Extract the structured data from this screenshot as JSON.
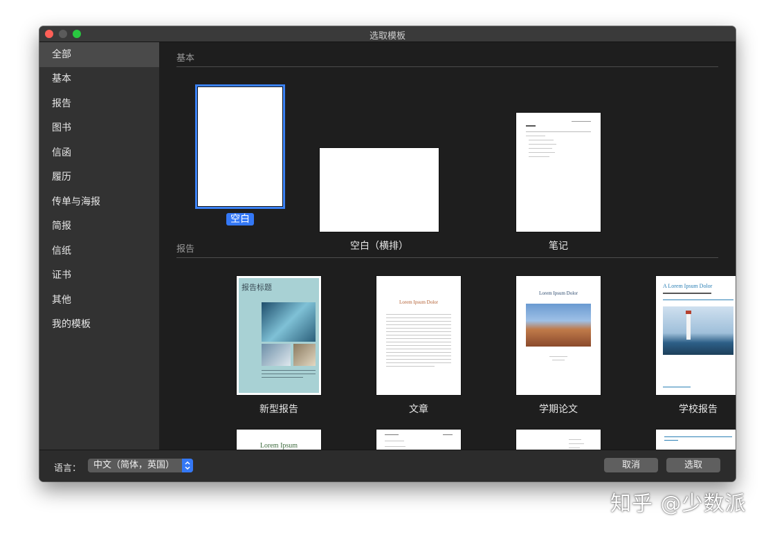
{
  "window": {
    "title": "选取模板"
  },
  "sidebar": {
    "items": [
      {
        "label": "全部",
        "selected": true
      },
      {
        "label": "基本"
      },
      {
        "label": "报告"
      },
      {
        "label": "图书"
      },
      {
        "label": "信函"
      },
      {
        "label": "履历"
      },
      {
        "label": "传单与海报"
      },
      {
        "label": "简报"
      },
      {
        "label": "信纸"
      },
      {
        "label": "证书"
      },
      {
        "label": "其他"
      },
      {
        "label": "我的模板"
      }
    ]
  },
  "sections": {
    "basic": {
      "title": "基本",
      "templates": [
        {
          "label": "空白",
          "selected": true
        },
        {
          "label": "空白（横排）"
        },
        {
          "label": "笔记"
        }
      ]
    },
    "reports": {
      "title": "报告",
      "templates": [
        {
          "label": "新型报告",
          "thumb_title": "报告标题"
        },
        {
          "label": "文章",
          "thumb_title": "Lorem Ipsum Dolor"
        },
        {
          "label": "学期论文",
          "thumb_title": "Lorem Ipsum Dolor"
        },
        {
          "label": "学校报告",
          "thumb_title": "A Lorem Ipsum Dolor"
        }
      ]
    },
    "next_row": {
      "partial_title": "Lorem Ipsum"
    }
  },
  "footer": {
    "language_label": "语言：",
    "language_value": "中文（简体，英国）",
    "cancel_label": "取消",
    "choose_label": "选取"
  },
  "watermark": "知乎 @少数派",
  "colors": {
    "accent": "#3478f6",
    "window_bg": "#1e1e1e",
    "sidebar_bg": "#323232"
  }
}
